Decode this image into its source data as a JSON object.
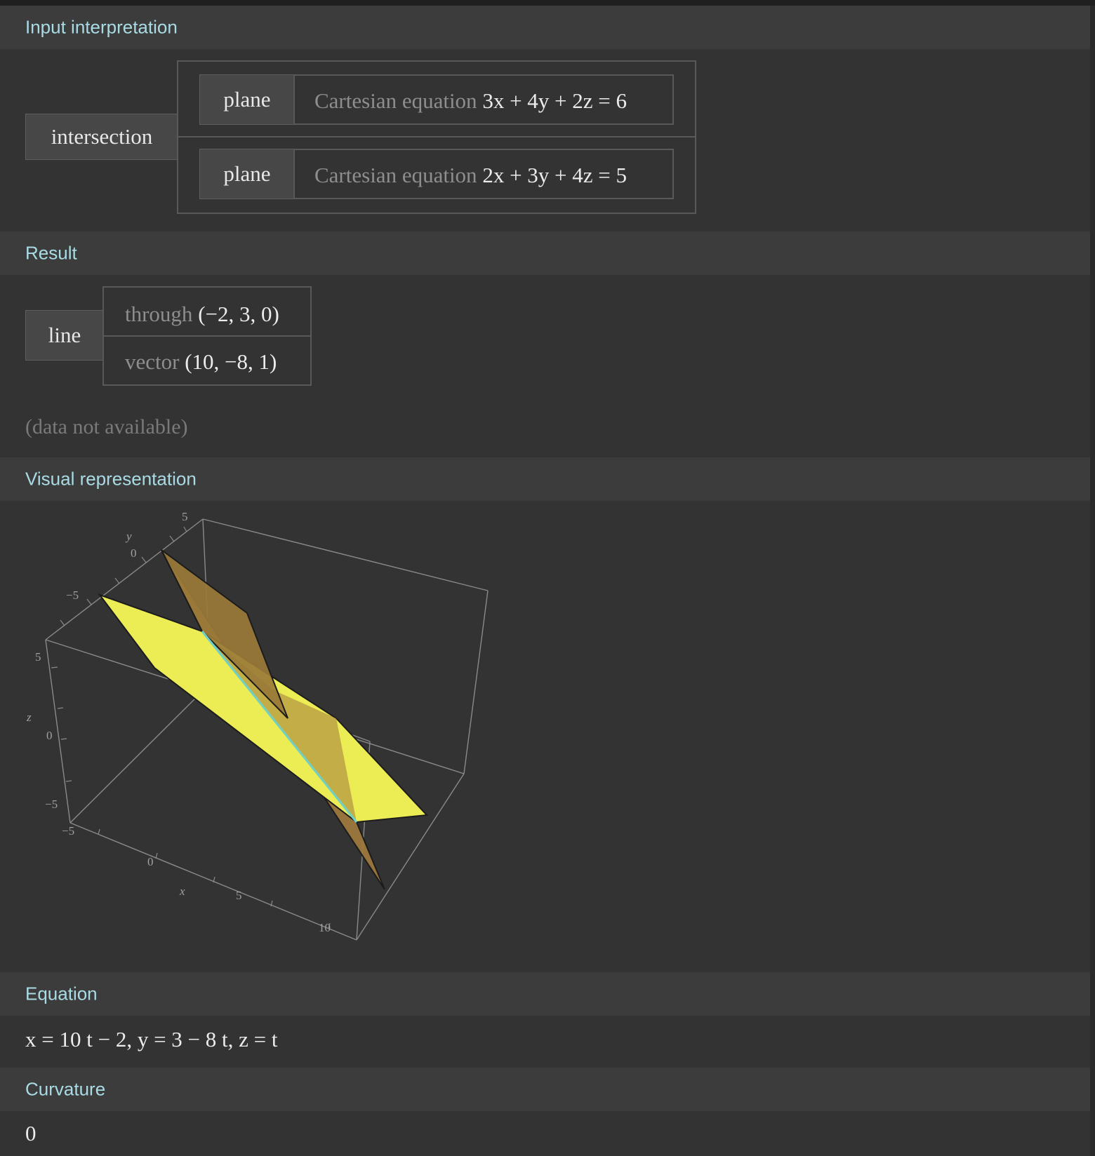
{
  "sections": {
    "input": "Input interpretation",
    "result": "Result",
    "visual": "Visual representation",
    "equation": "Equation",
    "curvature": "Curvature"
  },
  "input_interpretation": {
    "operation": "intersection",
    "planes": [
      {
        "kind": "plane",
        "prefix": "Cartesian equation",
        "equation": "3x + 4y + 2z = 6"
      },
      {
        "kind": "plane",
        "prefix": "Cartesian equation",
        "equation": "2x + 3y + 4z = 5"
      }
    ]
  },
  "result": {
    "kind": "line",
    "through_label": "through",
    "through_value": "(−2, 3, 0)",
    "vector_label": "vector",
    "vector_value": "(10, −8, 1)",
    "note": "(data not available)"
  },
  "plot": {
    "axes": {
      "y_label": "y",
      "z_label": "z",
      "x_label": "x",
      "y_ticks": [
        "5",
        "0",
        "−5"
      ],
      "z_ticks": [
        "5",
        "0",
        "−5"
      ],
      "x_ticks": [
        "−5",
        "0",
        "5",
        "10"
      ]
    },
    "colors": {
      "plane1": "#ecec55",
      "plane2": "#a07a3c",
      "edge": "#888888",
      "line": "#6fd0c8"
    }
  },
  "equation": {
    "text": "x = 10 t − 2, y = 3 − 8 t, z = t"
  },
  "curvature": {
    "value": "0"
  }
}
